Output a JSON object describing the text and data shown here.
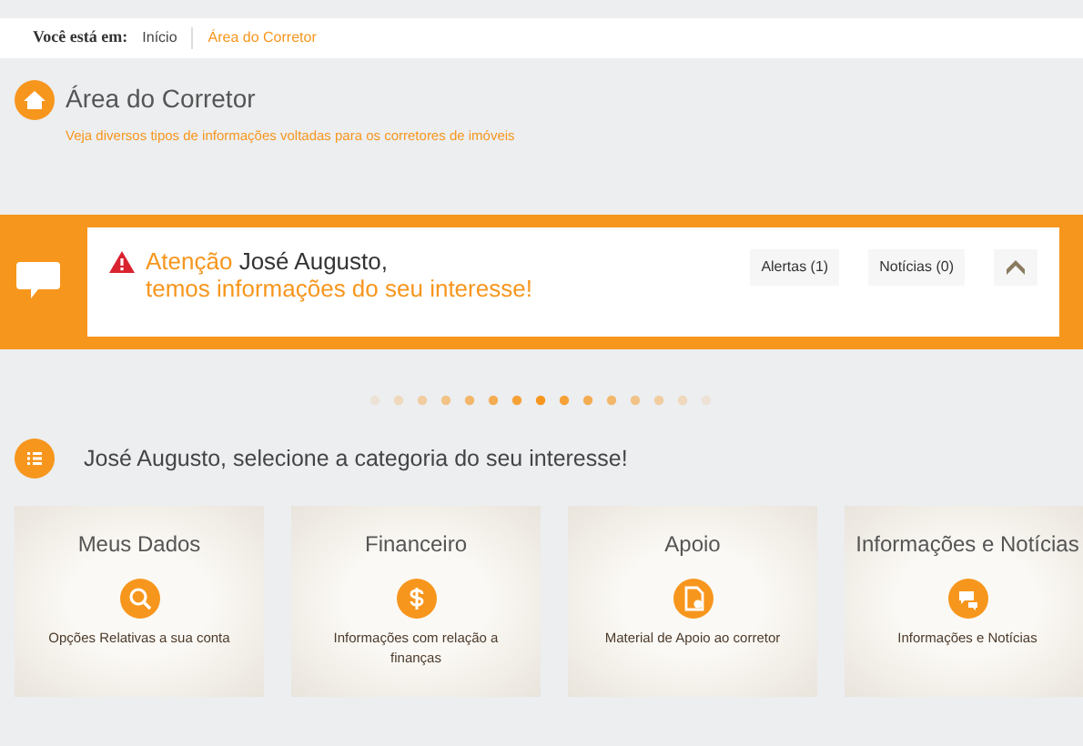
{
  "breadcrumb": {
    "label": "Você está em:",
    "items": [
      {
        "text": "Início",
        "selected": false
      },
      {
        "text": "Área do Corretor",
        "selected": true
      }
    ]
  },
  "header": {
    "title": "Área do Corretor",
    "subtitle": "Veja diversos tipos de informações voltadas para os corretores de imóveis"
  },
  "alert": {
    "prefix": "Atenção",
    "name": "José Augusto,",
    "message": "temos informações do seu interesse!",
    "buttons": [
      "Alertas (1)",
      "Notícias (0)"
    ]
  },
  "categories_heading": "José Augusto, selecione a categoria do seu interesse!",
  "categories": [
    {
      "title": "Meus Dados",
      "kind": "search",
      "description": "Opções Relativas a sua conta"
    },
    {
      "title": "Financeiro",
      "kind": "money",
      "description": "Informações com relação a finanças"
    },
    {
      "title": "Apoio",
      "kind": "document",
      "description": "Material de Apoio ao corretor"
    },
    {
      "title": "Informações e Notícias",
      "kind": "chat",
      "description": "Informações e Notícias"
    }
  ]
}
